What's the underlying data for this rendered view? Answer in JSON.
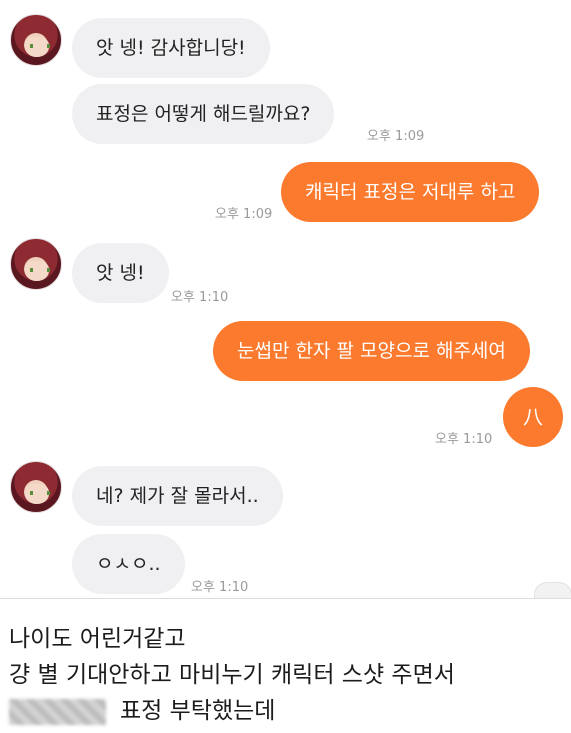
{
  "chat": {
    "messages": [
      {
        "text": "앗 넹! 감사합니당!"
      },
      {
        "text": "표정은 어떻게 해드릴까요?",
        "time": "오후 1:09"
      },
      {
        "text": "캐릭터 표정은 저대루 하고",
        "time": "오후 1:09"
      },
      {
        "text": "앗 넹!",
        "time": "오후 1:10"
      },
      {
        "text": "눈썹만 한자 팔 모양으로 해주세여"
      },
      {
        "text": "八",
        "time": "오후 1:10"
      },
      {
        "text": "네? 제가 잘 몰라서.."
      },
      {
        "text": "ㅇㅅㅇ..",
        "time": "오후 1:10"
      }
    ]
  },
  "caption": {
    "line1": "나이도 어린거같고",
    "line2": "걍 별 기대안하고 마비누기 캐릭터 스샷 주면서",
    "line3": "표정 부탁했는데"
  },
  "colors": {
    "outgoing_bubble": "#fb7a2e",
    "incoming_bubble": "#f0f0f3",
    "timestamp": "#9a9a9a"
  }
}
